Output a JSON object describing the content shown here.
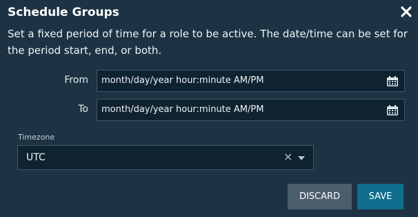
{
  "dialog": {
    "title": "Schedule Groups",
    "description": "Set a fixed period of time for a role to be active. The date/time can be set for the period start, end, or both."
  },
  "from": {
    "label": "From",
    "value": "month/day/year hour:minute AM/PM",
    "icon": "calendar-icon"
  },
  "to": {
    "label": "To",
    "value": "month/day/year hour:minute AM/PM",
    "icon": "calendar-icon"
  },
  "timezone": {
    "label": "Timezone",
    "value": "UTC",
    "clear_glyph": "×"
  },
  "buttons": {
    "discard": "DISCARD",
    "save": "SAVE"
  },
  "colors": {
    "background": "#1d3343",
    "field_background": "#0f2230",
    "save_button": "#0f6e8e",
    "discard_button": "#4a5e6c"
  }
}
